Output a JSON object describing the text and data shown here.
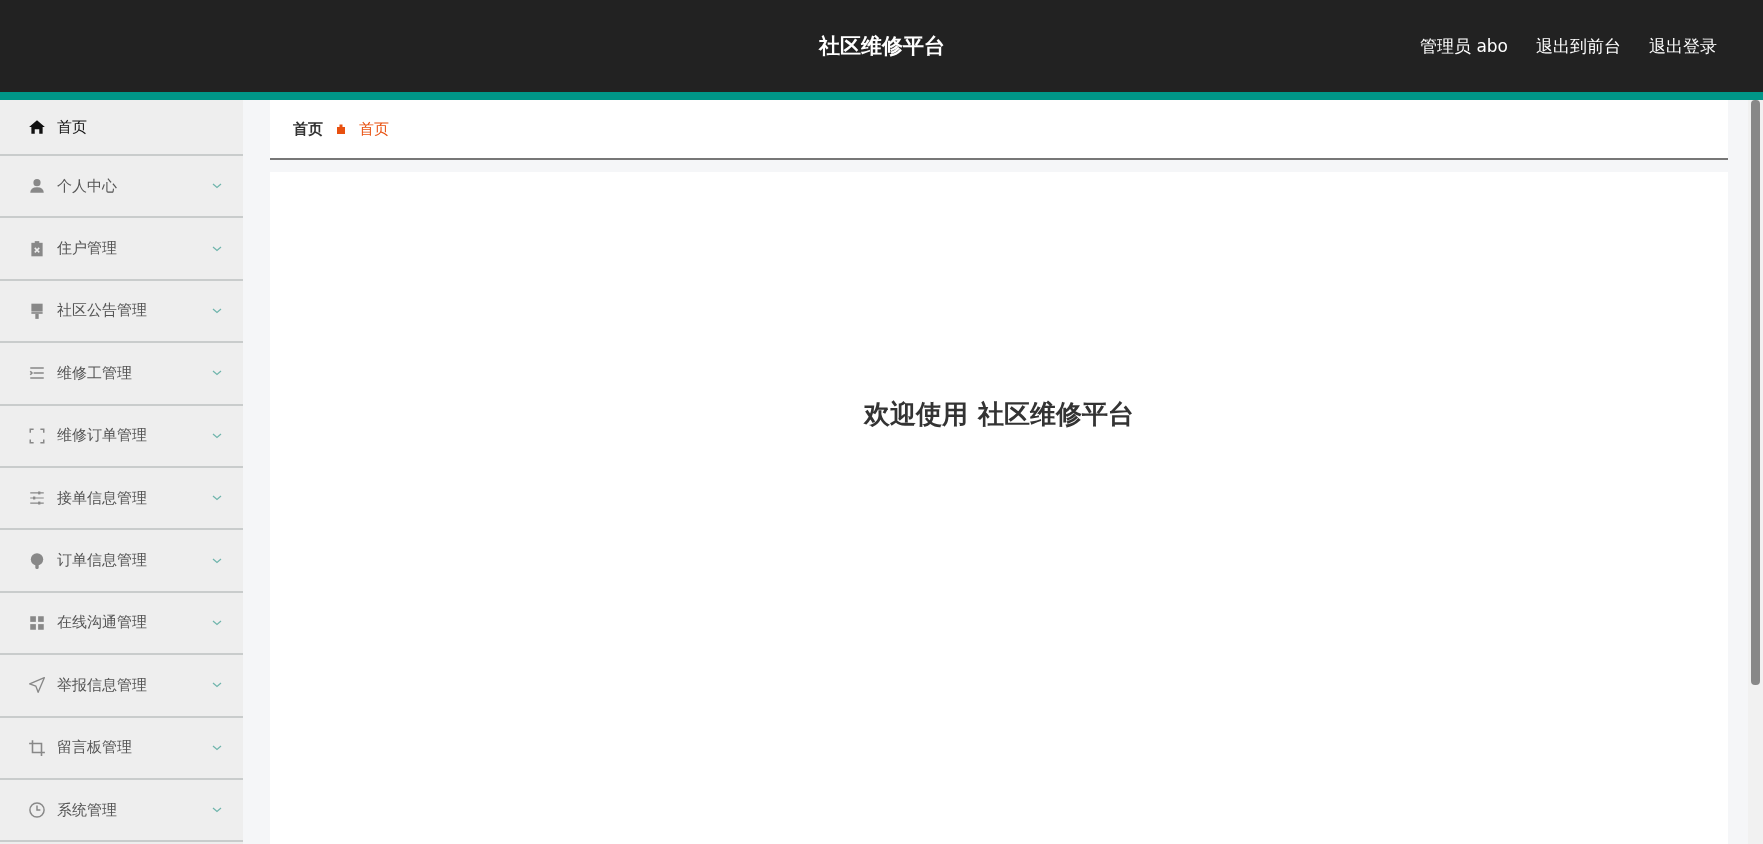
{
  "header": {
    "title": "社区维修平台",
    "user": "管理员 abo",
    "links": [
      "退出到前台",
      "退出登录"
    ]
  },
  "sidebar": {
    "items": [
      {
        "label": "首页",
        "selected": true,
        "expandable": false
      },
      {
        "label": "个人中心",
        "selected": false,
        "expandable": true
      },
      {
        "label": "住户管理",
        "selected": false,
        "expandable": true
      },
      {
        "label": "社区公告管理",
        "selected": false,
        "expandable": true
      },
      {
        "label": "维修工管理",
        "selected": false,
        "expandable": true
      },
      {
        "label": "维修订单管理",
        "selected": false,
        "expandable": true
      },
      {
        "label": "接单信息管理",
        "selected": false,
        "expandable": true
      },
      {
        "label": "订单信息管理",
        "selected": false,
        "expandable": true
      },
      {
        "label": "在线沟通管理",
        "selected": false,
        "expandable": true
      },
      {
        "label": "举报信息管理",
        "selected": false,
        "expandable": true
      },
      {
        "label": "留言板管理",
        "selected": false,
        "expandable": true
      },
      {
        "label": "系统管理",
        "selected": false,
        "expandable": true
      }
    ]
  },
  "breadcrumb": [
    {
      "label": "首页",
      "current": false
    },
    {
      "label": "首页",
      "current": true
    }
  ],
  "welcome": "欢迎使用 社区维修平台"
}
